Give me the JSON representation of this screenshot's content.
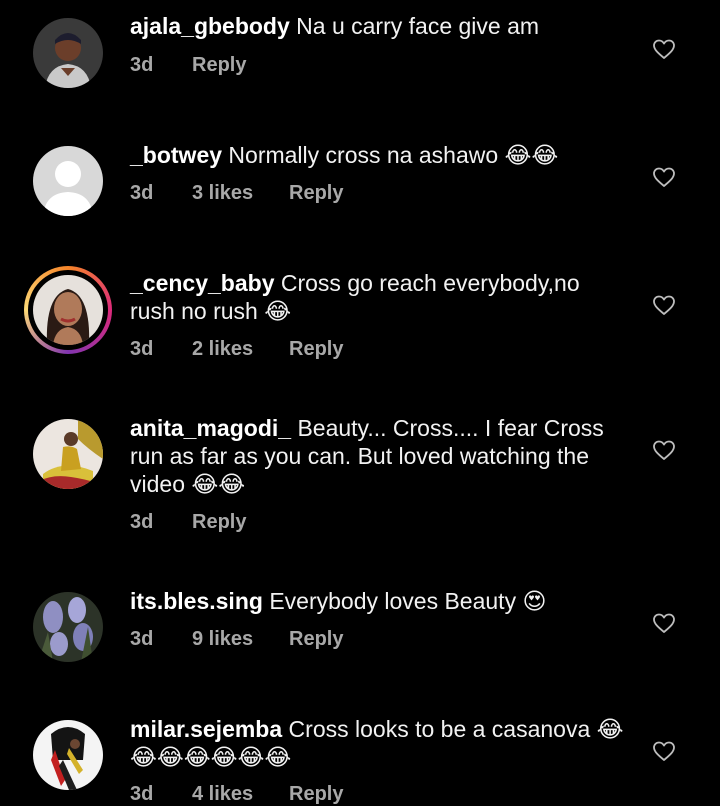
{
  "comments": [
    {
      "username": "ajala_gbebody",
      "text": "Na u carry face give am",
      "time": "3d",
      "likes": "",
      "reply": "Reply"
    },
    {
      "username": "_botwey",
      "text": "Normally cross na ashawo 😂😂",
      "time": "3d",
      "likes": "3 likes",
      "reply": "Reply"
    },
    {
      "username": "_cency_baby",
      "text": "Cross go reach everybody,no rush no rush 😂",
      "time": "3d",
      "likes": "2 likes",
      "reply": "Reply"
    },
    {
      "username": "anita_magodi_",
      "text": "Beauty... Cross.... I fear Cross run as far as you can. But loved watching the video 😂😂",
      "time": "3d",
      "likes": "",
      "reply": "Reply"
    },
    {
      "username": "its.bles.sing",
      "text": "Everybody loves Beauty 😍",
      "time": "3d",
      "likes": "9 likes",
      "reply": "Reply"
    },
    {
      "username": "milar.sejemba",
      "text": "Cross looks to be a casanova 😂😂😂😂😂😂😂",
      "time": "3d",
      "likes": "4 likes",
      "reply": "Reply"
    }
  ],
  "icons": {
    "like": "heart-outline-icon"
  },
  "colors": {
    "background": "#000000",
    "meta_text": "#a8a8a8",
    "text": "#ffffff"
  }
}
